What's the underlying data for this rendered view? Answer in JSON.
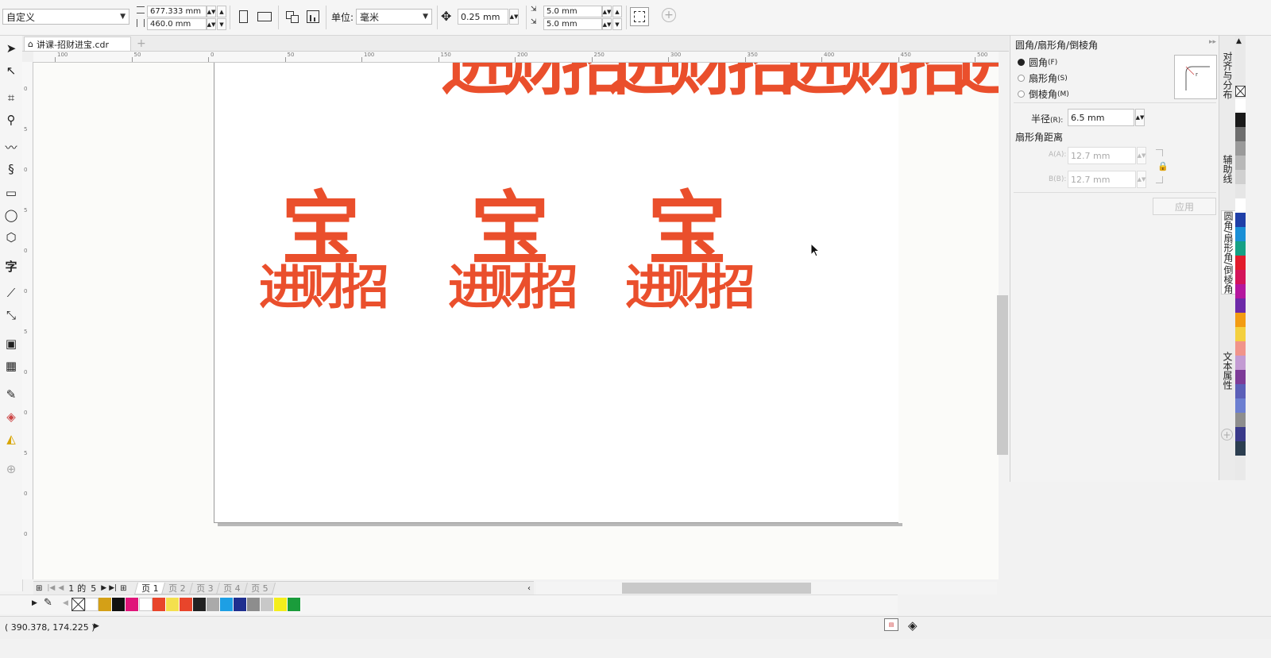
{
  "propbar": {
    "preset": "自定义",
    "width": "677.333 mm",
    "height": "460.0 mm",
    "units_label": "单位:",
    "units": "毫米",
    "nudge": "0.25 mm",
    "dup_x": "5.0 mm",
    "dup_y": "5.0 mm"
  },
  "doc_tab": "讲课-招财进宝.cdr",
  "ruler": {
    "h_ticks": [
      "100",
      "50",
      "0",
      "50",
      "100",
      "150",
      "200",
      "250",
      "300",
      "350",
      "400",
      "450",
      "500"
    ],
    "v_ticks": [
      "0",
      "5",
      "0",
      "5",
      "0",
      "0",
      "5",
      "0",
      "0",
      "5",
      "0",
      "0"
    ]
  },
  "artwork": {
    "top_glyph": "进财招",
    "stack_top": "宝",
    "stack_bottom": "进财招",
    "partial": "进"
  },
  "pagenav": {
    "current": "1",
    "of": "的",
    "total": "5",
    "tabs": [
      "页 1",
      "页 2",
      "页 3",
      "页 4",
      "页 5"
    ]
  },
  "palette_colors": [
    "#ffffff",
    "#d4a017",
    "#111111",
    "#e0157a",
    "#ffffff",
    "#e8452b",
    "#f4e04d",
    "#e8452b",
    "#222222",
    "#aaaaaa",
    "#1d9fe4",
    "#1f2f8f",
    "#8d8d8d",
    "#c8c8c8",
    "#f4ee1c",
    "#1a9c3b"
  ],
  "status": {
    "coords": "( 390.378, 174.225 )"
  },
  "docker": {
    "title": "圆角/扇形角/倒棱角",
    "options": [
      {
        "label": "圆角",
        "key": "(F)",
        "selected": true
      },
      {
        "label": "扇形角",
        "key": "(S)",
        "selected": false
      },
      {
        "label": "倒棱角",
        "key": "(M)",
        "selected": false
      }
    ],
    "radius_label": "半径",
    "radius_key": "(R):",
    "radius_value": "6.5 mm",
    "distance_title": "扇形角距离",
    "a_label": "A(A):",
    "a_value": "12.7 mm",
    "b_label": "B(B):",
    "b_value": "12.7 mm",
    "apply": "应用"
  },
  "docker_tabs": [
    "对齐与分布",
    "辅助线",
    "圆角/扇形角/倒棱角",
    "文本属性"
  ],
  "right_palette": [
    "#ffffff",
    "#1a1a1a",
    "#6e6e6e",
    "#9a9a9a",
    "#b8b8b8",
    "#d0d0d0",
    "#e6e6e6",
    "#ffffff",
    "#1f3fa8",
    "#1a8fd6",
    "#16a085",
    "#e21b2b",
    "#d4145a",
    "#b5179e",
    "#6d2aa8",
    "#f39c12",
    "#f4d03f",
    "#f1948a",
    "#c39bd3",
    "#7d3c98",
    "#5b5fb8",
    "#6c7fd1",
    "#8e8e8e",
    "#3a3a8a",
    "#2c3e50"
  ]
}
